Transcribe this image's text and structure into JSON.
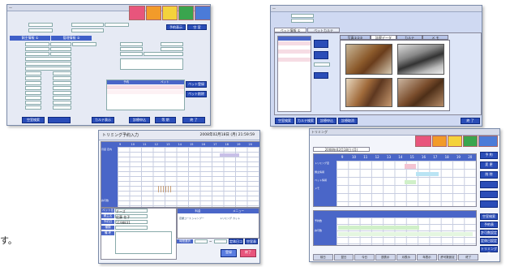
{
  "colors": {
    "primary_blue": "#2a4db8",
    "tab_pink": "#e8557c",
    "tab_orange": "#f29b2a",
    "tab_yellow": "#f4d23c",
    "tab_green": "#3aa54e",
    "tab_blue": "#4b7bd8",
    "header_band": "#3f5fc8"
  },
  "caption_text": "す。",
  "win1": {
    "title": "—",
    "tabs": [
      "",
      "",
      "",
      "",
      ""
    ],
    "buttons_right": [
      "予約表示",
      "空 室"
    ],
    "section_titles": [
      "飼主情報 ①",
      "管理情報 ②"
    ],
    "list_header": [
      "予約",
      "ペット"
    ],
    "side_buttons": [
      "ペット登録",
      "ペット削除"
    ],
    "bottom_buttons": [
      "空室検索",
      "",
      "カルテ表示",
      "診療申込",
      "等 期",
      "終 了"
    ]
  },
  "win2": {
    "title": "—",
    "header_fields": [
      "",
      ""
    ],
    "tabs": [
      "ペット情報 ①",
      "ペットカルテ"
    ],
    "photo_tabs": [
      "写真①②③",
      "診察データ",
      "カルテ",
      "メ モ"
    ],
    "bottom_buttons": [
      "空室検索",
      "カルテ検索",
      "診療申込",
      "診療取消",
      "終 了"
    ]
  },
  "win3": {
    "title": "トリミング予約入力",
    "date": "2008年02月18日 (月) 21:59:59",
    "hours": [
      "9",
      "10",
      "11",
      "12",
      "13",
      "14",
      "15",
      "16",
      "17",
      "18",
      "19",
      "20"
    ],
    "row_labels": [
      "月度 定内",
      "",
      "",
      "",
      "",
      "",
      "",
      "",
      "",
      "",
      "許可数"
    ],
    "form_labels": [
      "ペット名",
      "飼主名",
      "予約日",
      "種類",
      "備 考"
    ],
    "pet_no": "1198831",
    "pet_name": "チーズ",
    "owner_name": "佐藤 花子",
    "table_header": [
      "料金",
      "メニュー"
    ],
    "table_row": [
      "定額コース シャンプー",
      "トリミング カット"
    ],
    "bottom_labels": [
      "時間選択",
      "~",
      "定休日コピー",
      "空室表示"
    ],
    "bottom_buttons": [
      "登録",
      "終了"
    ]
  },
  "win4": {
    "title": "トリミング",
    "date_tab": "2008年02月18日 (月)",
    "hours": [
      "9",
      "10",
      "11",
      "12",
      "13",
      "14",
      "15",
      "16",
      "17",
      "18",
      "19",
      "20"
    ],
    "right_buttons": [
      "予 約",
      "変 更",
      "削 除",
      "",
      "",
      "",
      "空室検索",
      "予約表",
      "許可数設定",
      "定休日設定",
      "トリミング表"
    ],
    "row_labels": [
      "トリミング室",
      "飼主情報",
      "ペット情報",
      "メモ",
      "",
      "予約数",
      "許可数"
    ],
    "bottom_tabs": [
      "前日",
      "翌日",
      "今日",
      "週表示",
      "月表示",
      "年表示",
      "許可数設定",
      "終了"
    ]
  }
}
